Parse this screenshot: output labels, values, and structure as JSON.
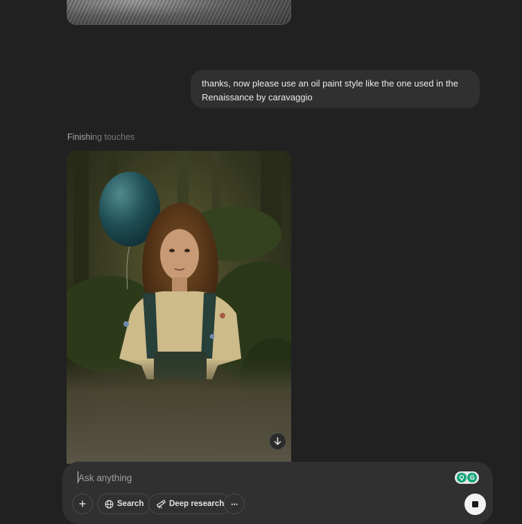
{
  "conversation": {
    "user_message": "thanks, now please use an oil paint style like the one used in the Renaissance by  caravaggio",
    "status": {
      "strong": "Finishi",
      "faded": "ng touches"
    }
  },
  "composer": {
    "placeholder": "Ask anything",
    "buttons": {
      "add_label": "+",
      "search_label": "Search",
      "deep_research_label": "Deep research",
      "more_label": "···"
    },
    "extension_letter": "G"
  },
  "icons": {
    "previous_image": "previous-generated-image",
    "download": "arrow-down-icon",
    "search": "globe-icon",
    "deep_research": "telescope-icon",
    "stop": "stop-icon"
  },
  "colors": {
    "background": "#212121",
    "bubble": "#303030",
    "accent_green": "#15a47a"
  }
}
